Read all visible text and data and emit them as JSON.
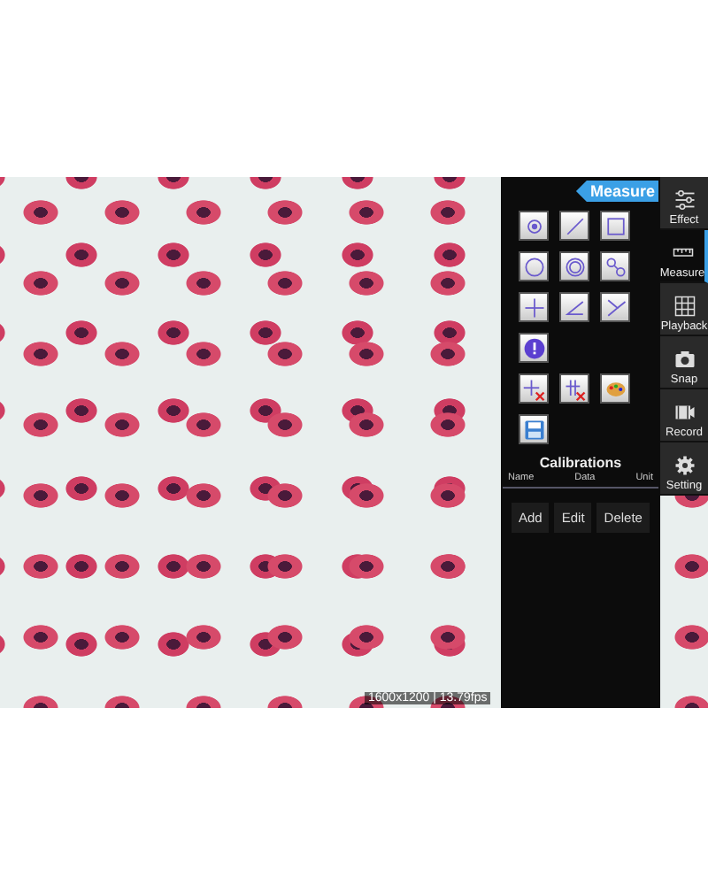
{
  "viewer": {
    "status": "1600x1200 | 13.79fps"
  },
  "panel": {
    "tag": "Measure",
    "tool_rows": [
      [
        {
          "kind": "point"
        },
        {
          "kind": "line"
        },
        {
          "kind": "rectangle"
        }
      ],
      [
        {
          "kind": "circle"
        },
        {
          "kind": "rings"
        },
        {
          "kind": "linked-circles"
        }
      ],
      [
        {
          "kind": "cross"
        },
        {
          "kind": "angle"
        },
        {
          "kind": "polyline"
        }
      ],
      [
        {
          "kind": "alert"
        }
      ],
      [
        {
          "kind": "delete-one"
        },
        {
          "kind": "delete-all"
        },
        {
          "kind": "palette"
        }
      ],
      [
        {
          "kind": "save"
        }
      ]
    ],
    "calibrations": {
      "title": "Calibrations",
      "columns": [
        "Name",
        "Data",
        "Unit"
      ]
    },
    "buttons": [
      "Add",
      "Edit",
      "Delete"
    ]
  },
  "sidebar": {
    "items": [
      {
        "label": "Effect",
        "kind": "sliders",
        "selected": false
      },
      {
        "label": "Measure",
        "kind": "ruler",
        "selected": true
      },
      {
        "label": "Playback",
        "kind": "grid",
        "selected": false
      },
      {
        "label": "Snap",
        "kind": "camera",
        "selected": false
      },
      {
        "label": "Record",
        "kind": "film",
        "selected": false
      },
      {
        "label": "Setting",
        "kind": "gear",
        "selected": false
      }
    ]
  }
}
